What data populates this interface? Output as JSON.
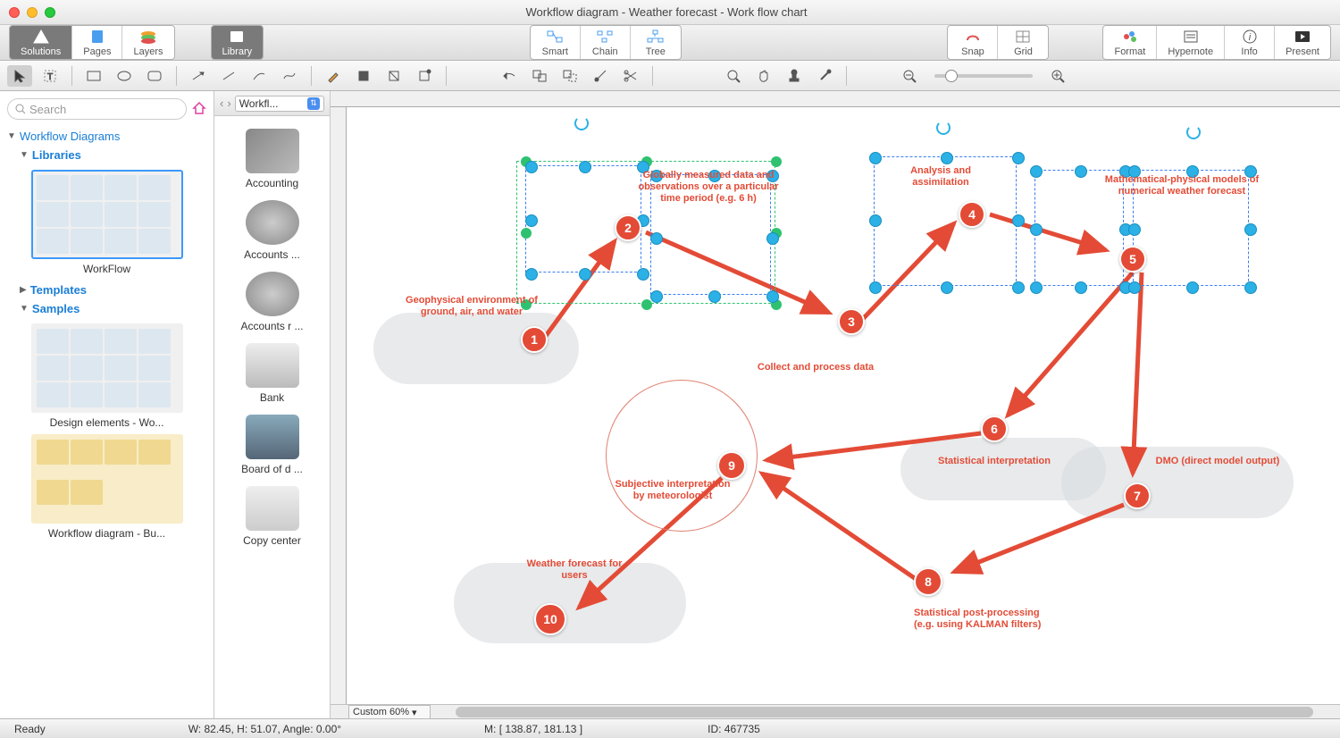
{
  "title": "Workflow diagram - Weather forecast - Work flow chart",
  "toolbar1": {
    "left": [
      "Solutions",
      "Pages",
      "Layers"
    ],
    "library": "Library",
    "middle": [
      "Smart",
      "Chain",
      "Tree"
    ],
    "snapgrid": [
      "Snap",
      "Grid"
    ],
    "right": [
      "Format",
      "Hypernote",
      "Info",
      "Present"
    ]
  },
  "search": {
    "placeholder": "Search"
  },
  "tree": {
    "root": "Workflow Diagrams",
    "libraries": "Libraries",
    "templates": "Templates",
    "samples": "Samples"
  },
  "thumbs": {
    "workflow": "WorkFlow",
    "design": "Design elements - Wo...",
    "bu": "Workflow diagram - Bu..."
  },
  "midpanel": {
    "selector": "Workfl...",
    "items": [
      "Accounting",
      "Accounts  ...",
      "Accounts r ...",
      "Bank",
      "Board of d ...",
      "Copy center"
    ]
  },
  "canvas": {
    "nodes": {
      "n1": "1",
      "n2": "2",
      "n3": "3",
      "n4": "4",
      "n5": "5",
      "n6": "6",
      "n7": "7",
      "n8": "8",
      "n9": "9",
      "n10": "10"
    },
    "labels": {
      "geo": "Geophysical environment of ground, air, and water",
      "global": "Globally measured data and observations over a particular time period (e.g. 6 h)",
      "collect": "Collect and process data",
      "analysis": "Analysis and assimilation",
      "math": "Mathematical-physical models of numerical weather forecast",
      "stat": "Statistical interpretation",
      "dmo": "DMO (direct model output)",
      "postproc": "Statistical post-processing (e.g. using KALMAN filters)",
      "subj": "Subjective interpretation by meteorologist",
      "wx": "Weather forecast for users"
    },
    "zoom_label": "Custom 60%"
  },
  "status": {
    "ready": "Ready",
    "whangle": "W: 82.45,  H: 51.07,  Angle: 0.00°",
    "mouse": "M: [ 138.87, 181.13 ]",
    "id": "ID: 467735"
  }
}
